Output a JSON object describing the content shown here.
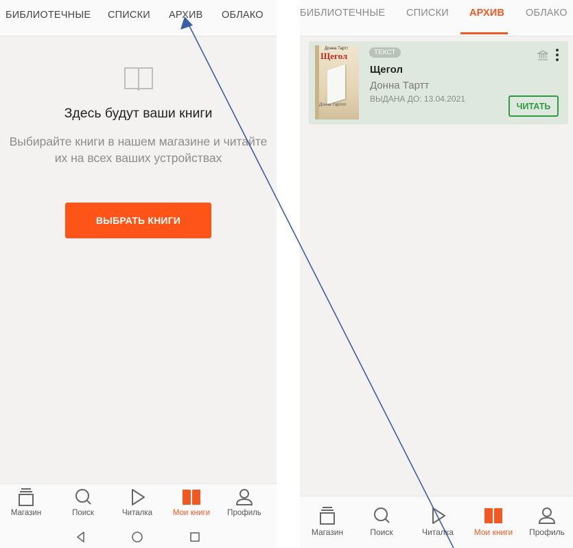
{
  "left": {
    "tabs": [
      {
        "label": "БИБЛИОТЕЧНЫЕ"
      },
      {
        "label": "СПИСКИ"
      },
      {
        "label": "АРХИВ"
      },
      {
        "label": "ОБЛАКО"
      }
    ],
    "empty_state": {
      "icon": "open-book-icon",
      "title": "Здесь будут ваши книги",
      "subtitle": "Выбирайте книги в нашем магазине и читайте их на всех ваших устройствах",
      "button_label": "ВЫБРАТЬ КНИГИ"
    },
    "bottom_nav": [
      {
        "label": "Магазин",
        "icon": "store-icon"
      },
      {
        "label": "Поиск",
        "icon": "search-icon"
      },
      {
        "label": "Читалка",
        "icon": "play-icon"
      },
      {
        "label": "Мои книги",
        "icon": "book-icon",
        "active": true
      },
      {
        "label": "Профиль",
        "icon": "profile-icon"
      }
    ],
    "system_nav": [
      "back-icon",
      "home-icon",
      "recents-icon"
    ]
  },
  "right": {
    "tabs": [
      {
        "label": "БИБЛИОТЕЧНЫЕ"
      },
      {
        "label": "СПИСКИ"
      },
      {
        "label": "АРХИВ",
        "active": true
      },
      {
        "label": "ОБЛАКО"
      }
    ],
    "book": {
      "badge": "ТЕКСТ",
      "title": "Щегол",
      "author": "Донна Тартт",
      "issued": "ВЫДАНА ДО: 13.04.2021",
      "read_label": "ЧИТАТЬ",
      "cover": {
        "author": "Донна Тартт",
        "title": "Щегол",
        "bottom_text": "Донна Тартт"
      }
    },
    "bottom_nav": [
      {
        "label": "Магазин",
        "icon": "store-icon"
      },
      {
        "label": "Поиск",
        "icon": "search-icon"
      },
      {
        "label": "Читалка",
        "icon": "play-icon"
      },
      {
        "label": "Мои книги",
        "icon": "book-icon",
        "active": true
      },
      {
        "label": "Профиль",
        "icon": "profile-icon"
      }
    ]
  },
  "colors": {
    "accent": "#f05a22",
    "button_orange": "#ff5417",
    "read_green": "#2e9c3c",
    "card_bg": "#dfe8df",
    "annotation_arrow": "#3a5fa8"
  }
}
